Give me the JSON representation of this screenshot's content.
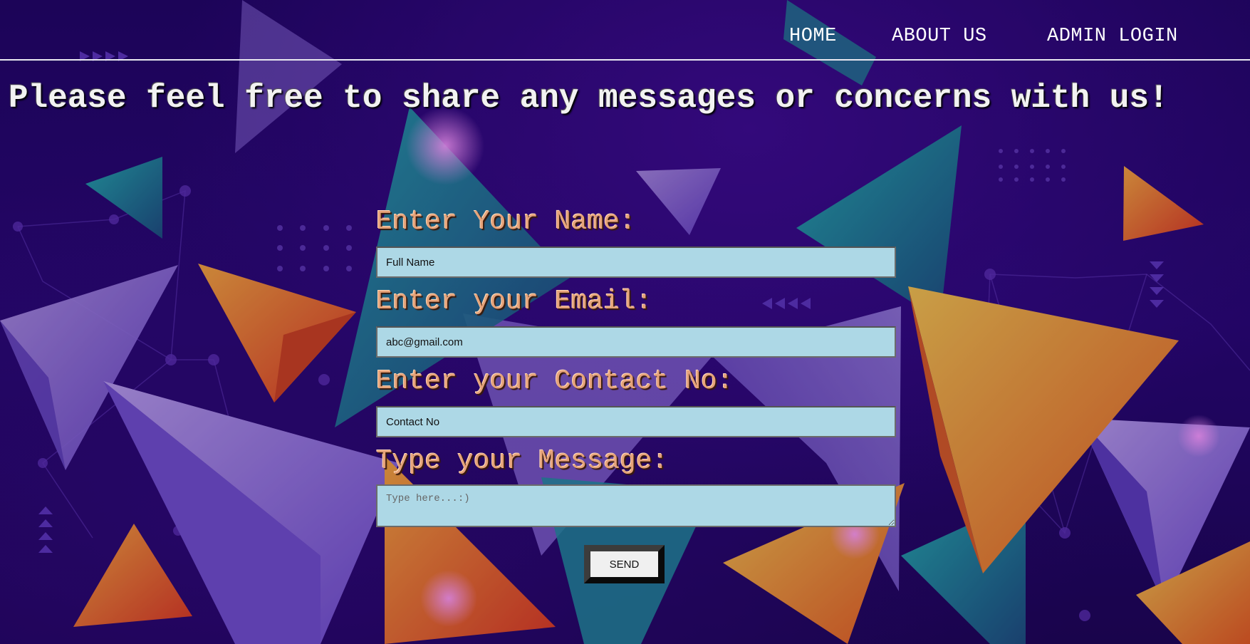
{
  "nav": {
    "items": [
      {
        "label": "HOME"
      },
      {
        "label": "ABOUT US"
      },
      {
        "label": "ADMIN LOGIN"
      }
    ]
  },
  "headline": "Please feel free to share any messages or concerns with us!",
  "form": {
    "name_label": "Enter Your Name:",
    "name_placeholder": "Full Name",
    "email_label": "Enter your Email:",
    "email_placeholder": "abc@gmail.com",
    "contact_label": "Enter your Contact No:",
    "contact_placeholder": "Contact No",
    "message_label": "Type your Message:",
    "message_placeholder": "Type here...:)",
    "send_label": "SEND"
  },
  "colors": {
    "background": "#25066f",
    "input_background": "#add8e6",
    "label_color": "#e6a37a",
    "nav_text": "#ffffff"
  }
}
